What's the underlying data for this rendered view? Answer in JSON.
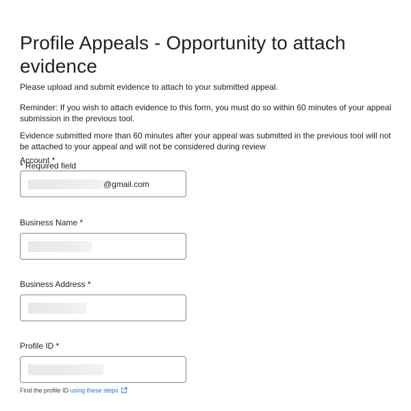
{
  "header": {
    "title": "Profile Appeals - Opportunity to attach evidence"
  },
  "intro": {
    "text": "Please upload and submit evidence to attach to your submitted appeal.",
    "reminder": "Reminder: If you wish to attach evidence to this form, you must do so within 60 minutes of your appeal submission in the previous tool.",
    "warning": "Evidence submitted more than 60 minutes after your appeal was submitted in the previous tool will not be attached to your appeal and will not be considered during review",
    "required_note": "* Required field"
  },
  "fields": {
    "account": {
      "label": "Account *",
      "value_suffix": "@gmail.com"
    },
    "business_name": {
      "label": "Business Name  *"
    },
    "business_address": {
      "label": "Business Address *"
    },
    "profile_id": {
      "label": "Profile ID *",
      "helper_text": "Find the profile ID",
      "helper_link": "using these steps",
      "helper_icon": "external-link-icon"
    }
  },
  "colors": {
    "link": "#1a73e8",
    "border": "#80868b",
    "text": "#202124"
  }
}
